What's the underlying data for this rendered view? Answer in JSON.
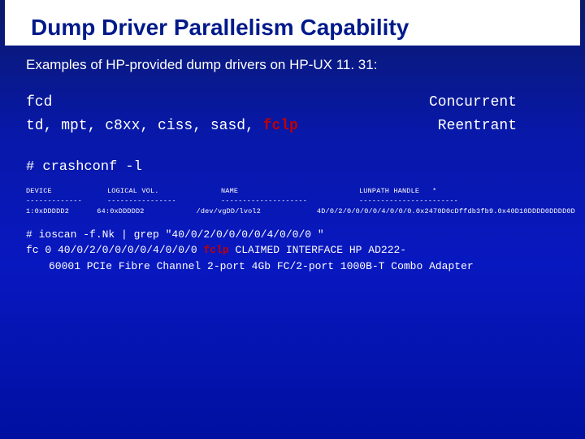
{
  "title": "Dump Driver Parallelism Capability",
  "subtitle": "Examples of HP-provided dump drivers on HP-UX 11. 31:",
  "rows": [
    {
      "left_a": "fcd",
      "left_b": "",
      "right": "Concurrent"
    },
    {
      "left_a": "td, mpt, c8xx, ciss, sasd, ",
      "left_b": "fclp",
      "right": "Reentrant"
    }
  ],
  "crashcmd": "# crashconf -l",
  "table": {
    "h1": "DEVICE",
    "h2": "LOGICAL VOL.",
    "h3": "NAME",
    "h4": "LUNPATH HANDLE",
    "h5": "*",
    "d1": "-------------",
    "d2": "----------------",
    "d3": "--------------------",
    "d4": "-----------------------",
    "r1": "1:0xDDDDD2",
    "r2": "64:0xDDDDD2",
    "r3": "/dev/vgDD/lvol2",
    "r4": "4D/0/2/0/0/0/0/4/0/0/0.0x2470D0cDffdb3fb9.0x40D10DDDD0DDDD0D"
  },
  "ioscan": {
    "cmd": "# ioscan -f.Nk | grep \"40/0/2/0/0/0/0/4/0/0/0 \"",
    "p1": "fc    0  40/0/2/0/0/0/0/4/0/0/0   ",
    "p2": "fclp",
    "p3": "    CLAIMED   INTERFACE   HP AD222-",
    "cont": "60001 PCIe Fibre Channel 2-port 4Gb FC/2-port 1000B-T Combo Adapter"
  }
}
